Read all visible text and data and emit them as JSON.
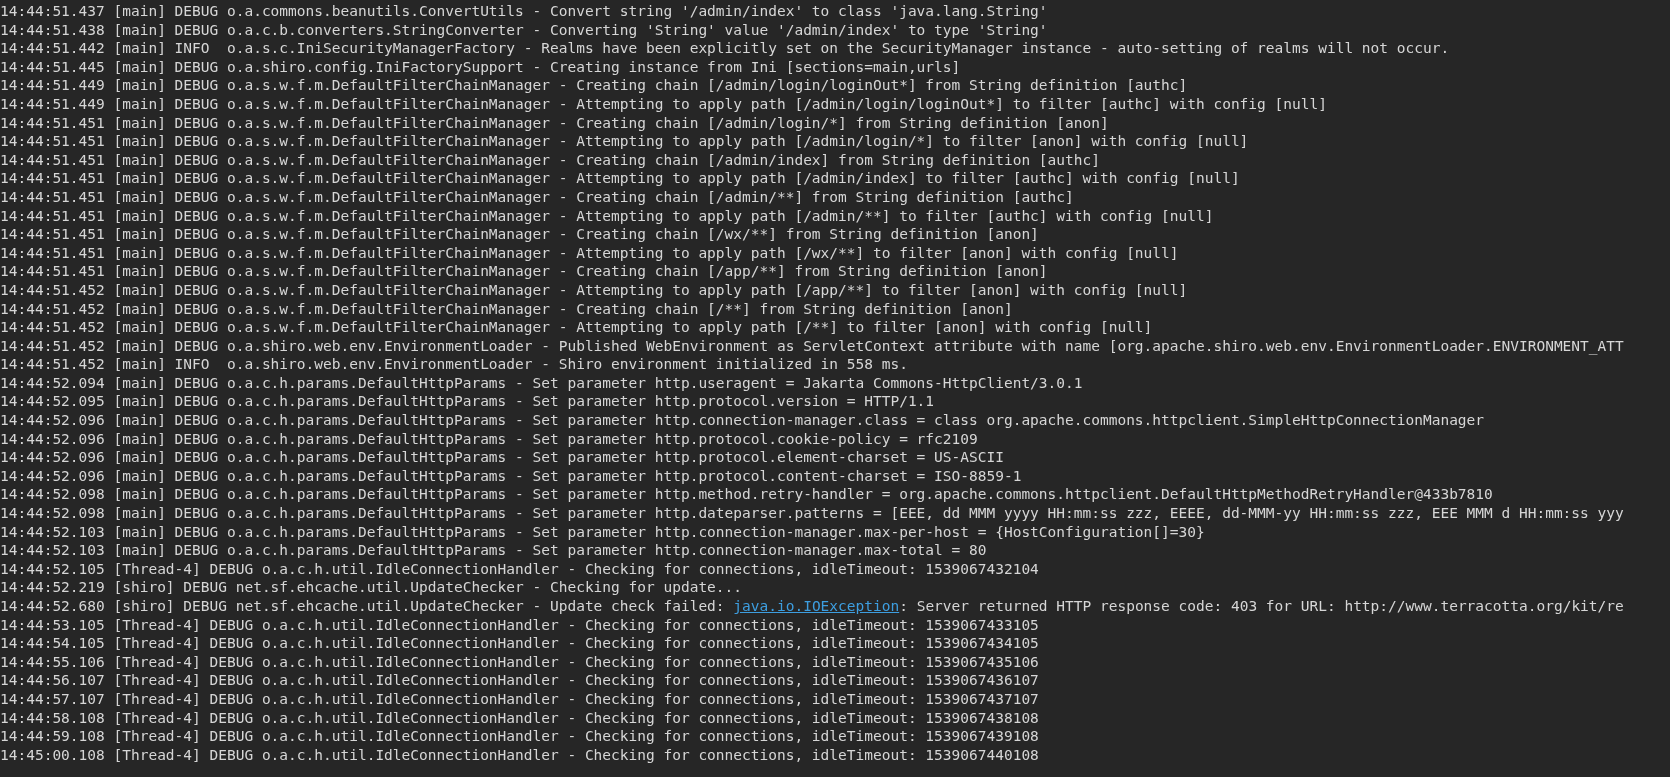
{
  "console": {
    "lines": [
      {
        "kind": "plain",
        "text": "14:44:51.437 [main] DEBUG o.a.commons.beanutils.ConvertUtils - Convert string '/admin/index' to class 'java.lang.String'"
      },
      {
        "kind": "plain",
        "text": "14:44:51.438 [main] DEBUG o.a.c.b.converters.StringConverter - Converting 'String' value '/admin/index' to type 'String'"
      },
      {
        "kind": "plain",
        "text": "14:44:51.442 [main] INFO  o.a.s.c.IniSecurityManagerFactory - Realms have been explicitly set on the SecurityManager instance - auto-setting of realms will not occur."
      },
      {
        "kind": "plain",
        "text": "14:44:51.445 [main] DEBUG o.a.shiro.config.IniFactorySupport - Creating instance from Ini [sections=main,urls]"
      },
      {
        "kind": "plain",
        "text": "14:44:51.449 [main] DEBUG o.a.s.w.f.m.DefaultFilterChainManager - Creating chain [/admin/login/loginOut*] from String definition [authc]"
      },
      {
        "kind": "plain",
        "text": "14:44:51.449 [main] DEBUG o.a.s.w.f.m.DefaultFilterChainManager - Attempting to apply path [/admin/login/loginOut*] to filter [authc] with config [null]"
      },
      {
        "kind": "plain",
        "text": "14:44:51.451 [main] DEBUG o.a.s.w.f.m.DefaultFilterChainManager - Creating chain [/admin/login/*] from String definition [anon]"
      },
      {
        "kind": "plain",
        "text": "14:44:51.451 [main] DEBUG o.a.s.w.f.m.DefaultFilterChainManager - Attempting to apply path [/admin/login/*] to filter [anon] with config [null]"
      },
      {
        "kind": "plain",
        "text": "14:44:51.451 [main] DEBUG o.a.s.w.f.m.DefaultFilterChainManager - Creating chain [/admin/index] from String definition [authc]"
      },
      {
        "kind": "plain",
        "text": "14:44:51.451 [main] DEBUG o.a.s.w.f.m.DefaultFilterChainManager - Attempting to apply path [/admin/index] to filter [authc] with config [null]"
      },
      {
        "kind": "plain",
        "text": "14:44:51.451 [main] DEBUG o.a.s.w.f.m.DefaultFilterChainManager - Creating chain [/admin/**] from String definition [authc]"
      },
      {
        "kind": "plain",
        "text": "14:44:51.451 [main] DEBUG o.a.s.w.f.m.DefaultFilterChainManager - Attempting to apply path [/admin/**] to filter [authc] with config [null]"
      },
      {
        "kind": "plain",
        "text": "14:44:51.451 [main] DEBUG o.a.s.w.f.m.DefaultFilterChainManager - Creating chain [/wx/**] from String definition [anon]"
      },
      {
        "kind": "plain",
        "text": "14:44:51.451 [main] DEBUG o.a.s.w.f.m.DefaultFilterChainManager - Attempting to apply path [/wx/**] to filter [anon] with config [null]"
      },
      {
        "kind": "plain",
        "text": "14:44:51.451 [main] DEBUG o.a.s.w.f.m.DefaultFilterChainManager - Creating chain [/app/**] from String definition [anon]"
      },
      {
        "kind": "plain",
        "text": "14:44:51.452 [main] DEBUG o.a.s.w.f.m.DefaultFilterChainManager - Attempting to apply path [/app/**] to filter [anon] with config [null]"
      },
      {
        "kind": "plain",
        "text": "14:44:51.452 [main] DEBUG o.a.s.w.f.m.DefaultFilterChainManager - Creating chain [/**] from String definition [anon]"
      },
      {
        "kind": "plain",
        "text": "14:44:51.452 [main] DEBUG o.a.s.w.f.m.DefaultFilterChainManager - Attempting to apply path [/**] to filter [anon] with config [null]"
      },
      {
        "kind": "plain",
        "text": "14:44:51.452 [main] DEBUG o.a.shiro.web.env.EnvironmentLoader - Published WebEnvironment as ServletContext attribute with name [org.apache.shiro.web.env.EnvironmentLoader.ENVIRONMENT_ATT"
      },
      {
        "kind": "plain",
        "text": "14:44:51.452 [main] INFO  o.a.shiro.web.env.EnvironmentLoader - Shiro environment initialized in 558 ms."
      },
      {
        "kind": "plain",
        "text": "14:44:52.094 [main] DEBUG o.a.c.h.params.DefaultHttpParams - Set parameter http.useragent = Jakarta Commons-HttpClient/3.0.1"
      },
      {
        "kind": "plain",
        "text": "14:44:52.095 [main] DEBUG o.a.c.h.params.DefaultHttpParams - Set parameter http.protocol.version = HTTP/1.1"
      },
      {
        "kind": "plain",
        "text": "14:44:52.096 [main] DEBUG o.a.c.h.params.DefaultHttpParams - Set parameter http.connection-manager.class = class org.apache.commons.httpclient.SimpleHttpConnectionManager"
      },
      {
        "kind": "plain",
        "text": "14:44:52.096 [main] DEBUG o.a.c.h.params.DefaultHttpParams - Set parameter http.protocol.cookie-policy = rfc2109"
      },
      {
        "kind": "plain",
        "text": "14:44:52.096 [main] DEBUG o.a.c.h.params.DefaultHttpParams - Set parameter http.protocol.element-charset = US-ASCII"
      },
      {
        "kind": "plain",
        "text": "14:44:52.096 [main] DEBUG o.a.c.h.params.DefaultHttpParams - Set parameter http.protocol.content-charset = ISO-8859-1"
      },
      {
        "kind": "plain",
        "text": "14:44:52.098 [main] DEBUG o.a.c.h.params.DefaultHttpParams - Set parameter http.method.retry-handler = org.apache.commons.httpclient.DefaultHttpMethodRetryHandler@433b7810"
      },
      {
        "kind": "plain",
        "text": "14:44:52.098 [main] DEBUG o.a.c.h.params.DefaultHttpParams - Set parameter http.dateparser.patterns = [EEE, dd MMM yyyy HH:mm:ss zzz, EEEE, dd-MMM-yy HH:mm:ss zzz, EEE MMM d HH:mm:ss yyy"
      },
      {
        "kind": "plain",
        "text": "14:44:52.103 [main] DEBUG o.a.c.h.params.DefaultHttpParams - Set parameter http.connection-manager.max-per-host = {HostConfiguration[]=30}"
      },
      {
        "kind": "plain",
        "text": "14:44:52.103 [main] DEBUG o.a.c.h.params.DefaultHttpParams - Set parameter http.connection-manager.max-total = 80"
      },
      {
        "kind": "plain",
        "text": "14:44:52.105 [Thread-4] DEBUG o.a.c.h.util.IdleConnectionHandler - Checking for connections, idleTimeout: 1539067432104"
      },
      {
        "kind": "plain",
        "text": "14:44:52.219 [shiro] DEBUG net.sf.ehcache.util.UpdateChecker - Checking for update..."
      },
      {
        "kind": "link",
        "text": "14:44:52.680 [shiro] DEBUG net.sf.ehcache.util.UpdateChecker - Update check failed: ",
        "link": "java.io.IOException",
        "rest": ": Server returned HTTP response code: 403 for URL: http://www.terracotta.org/kit/re"
      },
      {
        "kind": "plain",
        "text": "14:44:53.105 [Thread-4] DEBUG o.a.c.h.util.IdleConnectionHandler - Checking for connections, idleTimeout: 1539067433105"
      },
      {
        "kind": "plain",
        "text": "14:44:54.105 [Thread-4] DEBUG o.a.c.h.util.IdleConnectionHandler - Checking for connections, idleTimeout: 1539067434105"
      },
      {
        "kind": "plain",
        "text": "14:44:55.106 [Thread-4] DEBUG o.a.c.h.util.IdleConnectionHandler - Checking for connections, idleTimeout: 1539067435106"
      },
      {
        "kind": "plain",
        "text": "14:44:56.107 [Thread-4] DEBUG o.a.c.h.util.IdleConnectionHandler - Checking for connections, idleTimeout: 1539067436107"
      },
      {
        "kind": "plain",
        "text": "14:44:57.107 [Thread-4] DEBUG o.a.c.h.util.IdleConnectionHandler - Checking for connections, idleTimeout: 1539067437107"
      },
      {
        "kind": "plain",
        "text": "14:44:58.108 [Thread-4] DEBUG o.a.c.h.util.IdleConnectionHandler - Checking for connections, idleTimeout: 1539067438108"
      },
      {
        "kind": "plain",
        "text": "14:44:59.108 [Thread-4] DEBUG o.a.c.h.util.IdleConnectionHandler - Checking for connections, idleTimeout: 1539067439108"
      },
      {
        "kind": "plain",
        "text": "14:45:00.108 [Thread-4] DEBUG o.a.c.h.util.IdleConnectionHandler - Checking for connections, idleTimeout: 1539067440108"
      }
    ]
  }
}
